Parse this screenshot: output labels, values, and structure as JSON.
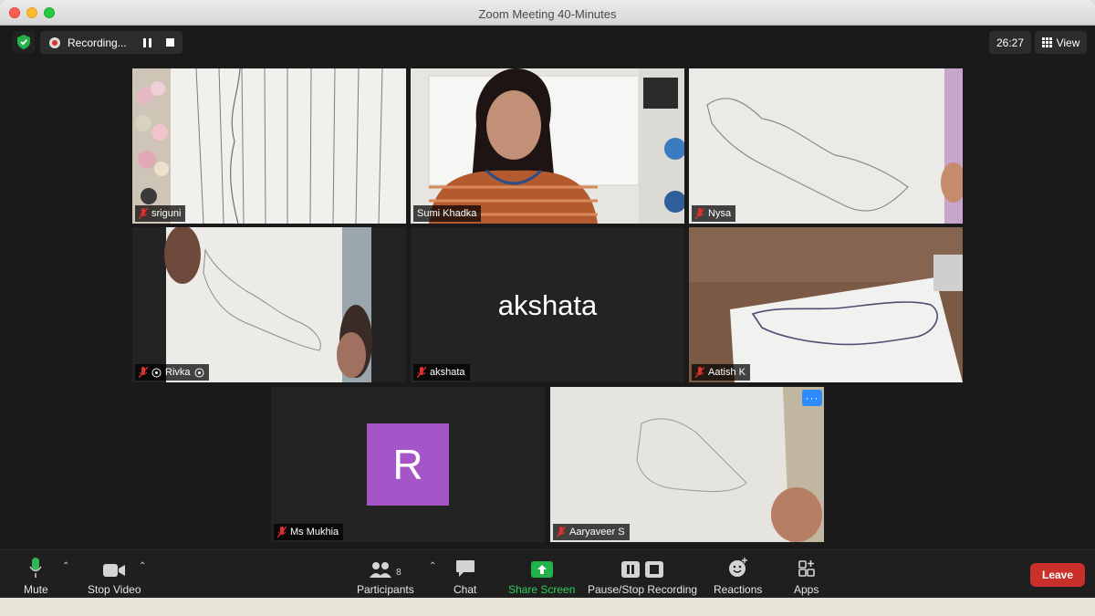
{
  "window": {
    "title": "Zoom Meeting   40-Minutes"
  },
  "topbar": {
    "recording_label": "Recording...",
    "timer": "26:27",
    "view_label": "View"
  },
  "participants": [
    {
      "name": "sriguni"
    },
    {
      "name": "Sumi Khadka"
    },
    {
      "name": "Nysa"
    },
    {
      "name": "Rivka",
      "prefix_icon": "share-icon",
      "suffix_icon": "share-icon"
    },
    {
      "name": "akshata",
      "big_name": "akshata"
    },
    {
      "name": "Aatish K"
    },
    {
      "name": "Ms Mukhia",
      "avatar_letter": "R"
    },
    {
      "name": "Aaryaveer S"
    }
  ],
  "toolbar": {
    "mute": "Mute",
    "stop_video": "Stop Video",
    "participants": "Participants",
    "participant_count": "8",
    "chat": "Chat",
    "share_screen": "Share Screen",
    "pause_stop_recording": "Pause/Stop Recording",
    "reactions": "Reactions",
    "apps": "Apps",
    "leave": "Leave"
  },
  "colors": {
    "active_speaker": "#c9e86b",
    "share_green": "#22b24c",
    "leave_red": "#c9302c",
    "avatar_purple": "#a655c8"
  }
}
